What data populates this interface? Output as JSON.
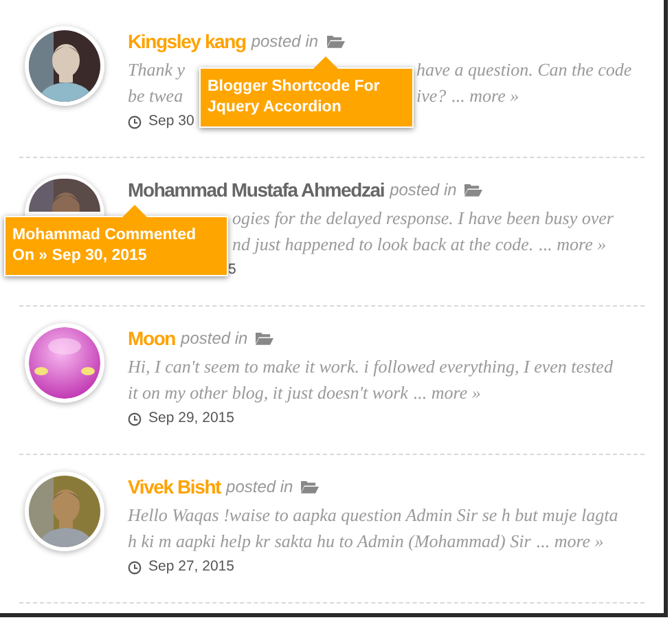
{
  "comments": [
    {
      "author": "Kingsley kang",
      "hovered": false,
      "posted_in": "posted in",
      "lines": [
        {
          "before_popup": "Thank y",
          "after_popup": "have a question. Can the code"
        },
        {
          "before_popup": "be twea",
          "after_popup": "ive?",
          "more": "... more »"
        }
      ],
      "date": "Sep 30",
      "popup": {
        "kind": "category",
        "text": "Blogger Shortcode For Jquery Accordion"
      }
    },
    {
      "author": "Mohammad Mustafa Ahmedzai",
      "hovered": true,
      "posted_in": "posted in",
      "lines": [
        {
          "after_popup": "ogies for the delayed response. I have been busy over"
        },
        {
          "after_popup": "nd just happened to look back at the code.",
          "more": "... more »"
        }
      ],
      "date": "5",
      "popup": {
        "kind": "comment_date",
        "text": "Mohammad Commented On » Sep 30, 2015"
      }
    },
    {
      "author": "Moon",
      "hovered": false,
      "posted_in": "posted in",
      "lines": [
        {
          "after_popup": "Hi, I can't seem to make it work. i followed everything, I even tested"
        },
        {
          "after_popup": "it on my other blog, it just doesn't work",
          "more": "... more »"
        }
      ],
      "date": "Sep 29, 2015"
    },
    {
      "author": "Vivek Bisht",
      "hovered": false,
      "posted_in": "posted in",
      "lines": [
        {
          "after_popup": "Hello Waqas !waise to aapka question Admin Sir se h but muje lagta"
        },
        {
          "after_popup": "h ki m aapki help kr sakta hu to Admin (Mohammad) Sir",
          "more": "... more »"
        }
      ],
      "date": "Sep 27, 2015"
    }
  ]
}
